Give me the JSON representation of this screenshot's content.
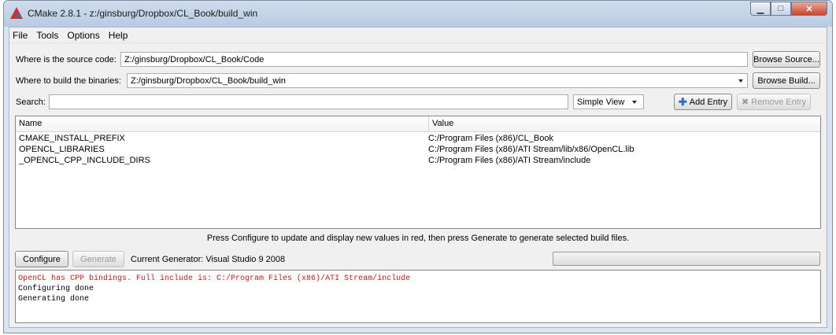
{
  "window": {
    "title": "CMake 2.8.1 - z:/ginsburg/Dropbox/CL_Book/build_win",
    "buttons": [
      "minimize-icon",
      "maximize-icon",
      "close-icon"
    ]
  },
  "menu": [
    "File",
    "Tools",
    "Options",
    "Help"
  ],
  "source": {
    "label": "Where is the source code:",
    "value": "Z:/ginsburg/Dropbox/CL_Book/Code",
    "button": "Browse Source..."
  },
  "build": {
    "label": "Where to build the binaries:",
    "value": "Z:/ginsburg/Dropbox/CL_Book/build_win",
    "button": "Browse Build..."
  },
  "search": {
    "label": "Search:",
    "value": "",
    "view": "Simple View",
    "add": "Add Entry",
    "remove": "Remove Entry"
  },
  "table": {
    "headers": [
      "Name",
      "Value"
    ],
    "rows": [
      {
        "name": "CMAKE_INSTALL_PREFIX",
        "value": "C:/Program Files (x86)/CL_Book"
      },
      {
        "name": "OPENCL_LIBRARIES",
        "value": "C:/Program Files (x86)/ATI Stream/lib/x86/OpenCL.lib"
      },
      {
        "name": "_OPENCL_CPP_INCLUDE_DIRS",
        "value": "C:/Program Files (x86)/ATI Stream/include"
      }
    ]
  },
  "hint": "Press Configure to update and display new values in red, then press Generate to generate selected build files.",
  "actions": {
    "configure": "Configure",
    "generate": "Generate",
    "generator": "Current Generator: Visual Studio 9 2008"
  },
  "progress": 0,
  "output": [
    {
      "text": "OpenCL has CPP bindings. Full include is: C:/Program Files (x86)/ATI Stream/include",
      "error": true
    },
    {
      "text": "Configuring done",
      "error": false
    },
    {
      "text": "Generating done",
      "error": false
    }
  ],
  "colors": {
    "error_text": "#d01919",
    "title_gradient": "#b9cbe2"
  }
}
